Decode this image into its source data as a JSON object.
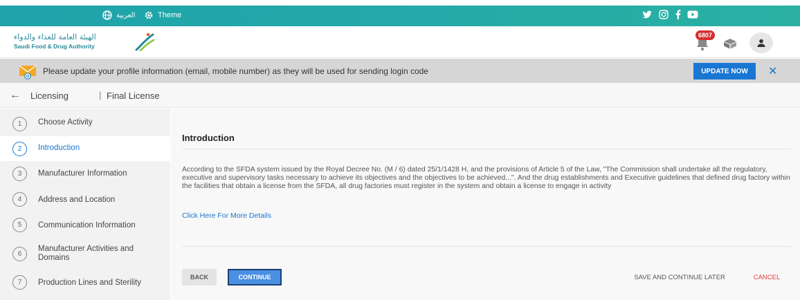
{
  "topbar": {
    "language_label": "العربية",
    "theme_label": "Theme",
    "social_icons": [
      "twitter-icon",
      "instagram-icon",
      "facebook-icon",
      "youtube-icon"
    ]
  },
  "header": {
    "logo_arabic": "الهيئة العامة للغذاء والدواء",
    "logo_english": "Saudi Food & Drug Authority",
    "notification_count": "6807"
  },
  "banner": {
    "message": "Please update your profile information (email, mobile number) as they will be used for sending login code",
    "update_label": "UPDATE NOW",
    "close_label": "✕"
  },
  "breadcrumb": {
    "back_label": "←",
    "section": "Licensing",
    "separator": "|",
    "page": "Final License"
  },
  "steps": [
    {
      "num": "1",
      "label": "Choose Activity",
      "active": false
    },
    {
      "num": "2",
      "label": "Introduction",
      "active": true
    },
    {
      "num": "3",
      "label": "Manufacturer Information",
      "active": false
    },
    {
      "num": "4",
      "label": "Address and Location",
      "active": false
    },
    {
      "num": "5",
      "label": "Communication Information",
      "active": false
    },
    {
      "num": "6",
      "label": "Manufacturer Activities and Domains",
      "active": false
    },
    {
      "num": "7",
      "label": "Production Lines and Sterility",
      "active": false
    }
  ],
  "main": {
    "title": "Introduction",
    "paragraph": "According to the SFDA system issued by the Royal Decree No. (M / 6) dated 25/1/1428 H, and the provisions of Article 5 of the Law, \"The Commission shall undertake all the regulatory, executive and supervisory tasks necessary to achieve its objectives and the objectives to be achieved...\". And the drug establishments and Executive guidelines that defined drug factory within the facilities that obtain a license from the SFDA, all drug factories must register in the system and obtain a license to engage in activity",
    "more_link": "Click Here For More Details",
    "back_label": "BACK",
    "continue_label": "CONTINUE",
    "save_later_label": "SAVE AND CONTINUE LATER",
    "cancel_label": "CANCEL"
  },
  "colors": {
    "topbar": "#22a8a9",
    "accent": "#1976d2",
    "danger": "#e53935",
    "badge": "#d32f2f"
  }
}
